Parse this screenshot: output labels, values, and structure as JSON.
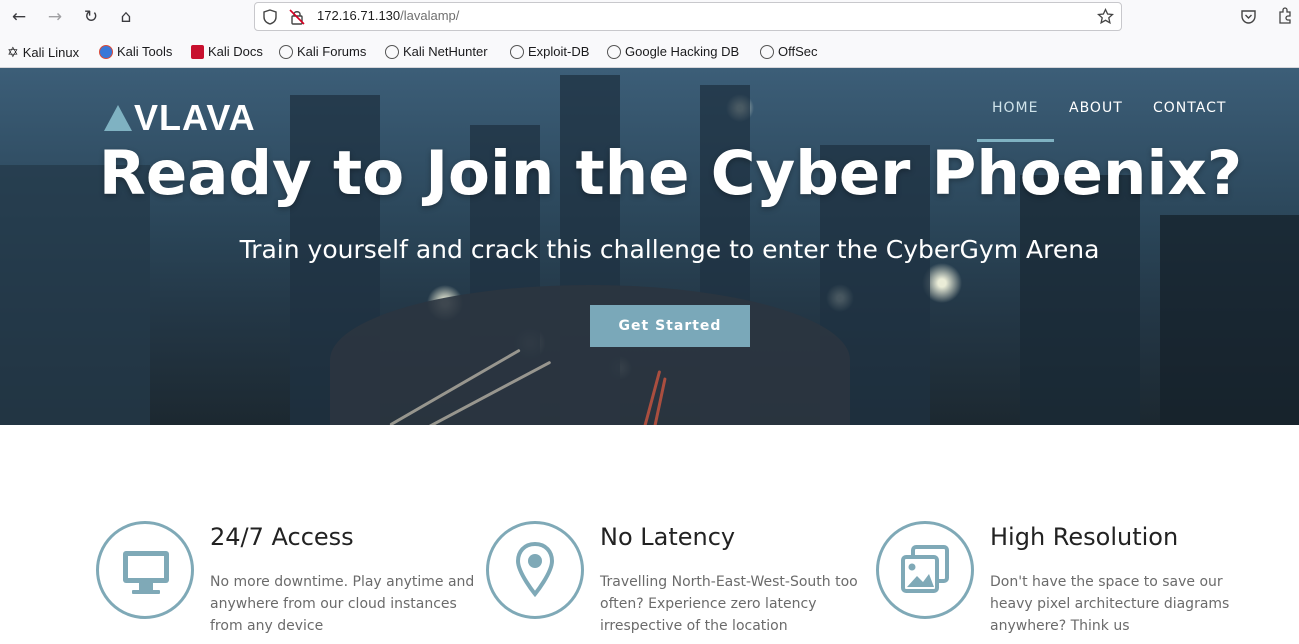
{
  "browser": {
    "url_host": "172.16.71.130",
    "url_path": "/lavalamp/",
    "bookmarks": [
      "Kali Linux",
      "Kali Tools",
      "Kali Docs",
      "Kali Forums",
      "Kali NetHunter",
      "Exploit-DB",
      "Google Hacking DB",
      "OffSec"
    ]
  },
  "site": {
    "logo": "VLAVA",
    "nav": [
      "HOME",
      "ABOUT",
      "CONTACT"
    ],
    "hero_title": "Ready to Join the Cyber Phoenix?",
    "hero_subtitle": "Train yourself and crack this challenge to enter the CyberGym Arena",
    "cta_label": "Get Started"
  },
  "features": [
    {
      "icon": "monitor-icon",
      "title": "24/7 Access",
      "text": "No more downtime. Play anytime and anywhere from our cloud instances from any device"
    },
    {
      "icon": "map-pin-icon",
      "title": "No Latency",
      "text": "Travelling North-East-West-South too often? Experience zero latency irrespective of the location"
    },
    {
      "icon": "images-icon",
      "title": "High Resolution",
      "text": "Don't have the space to save our heavy pixel architecture diagrams anywhere? Think us"
    }
  ],
  "colors": {
    "accent": "#7fb2c2",
    "button": "#7aa8b9"
  }
}
